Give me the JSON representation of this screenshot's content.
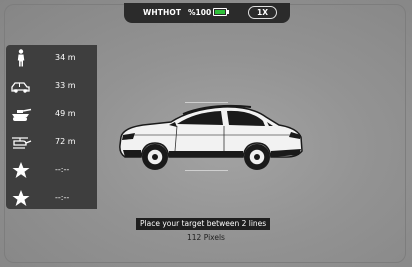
{
  "status": {
    "mode": "WHTHOT",
    "battery": "%100",
    "battery_level": 1.0,
    "battery_color": "#2fbf3a",
    "zoom": "1X"
  },
  "targets": [
    {
      "icon": "person-icon",
      "distance": "34 m"
    },
    {
      "icon": "car-icon",
      "distance": "33 m"
    },
    {
      "icon": "tank-icon",
      "distance": "49 m"
    },
    {
      "icon": "helicopter-icon",
      "distance": "72 m"
    },
    {
      "icon": "star-icon",
      "distance": "--:--"
    },
    {
      "icon": "star-icon",
      "distance": "--:--"
    }
  ],
  "hint": "Place your target between 2 lines",
  "pixels": "112 Pixels"
}
